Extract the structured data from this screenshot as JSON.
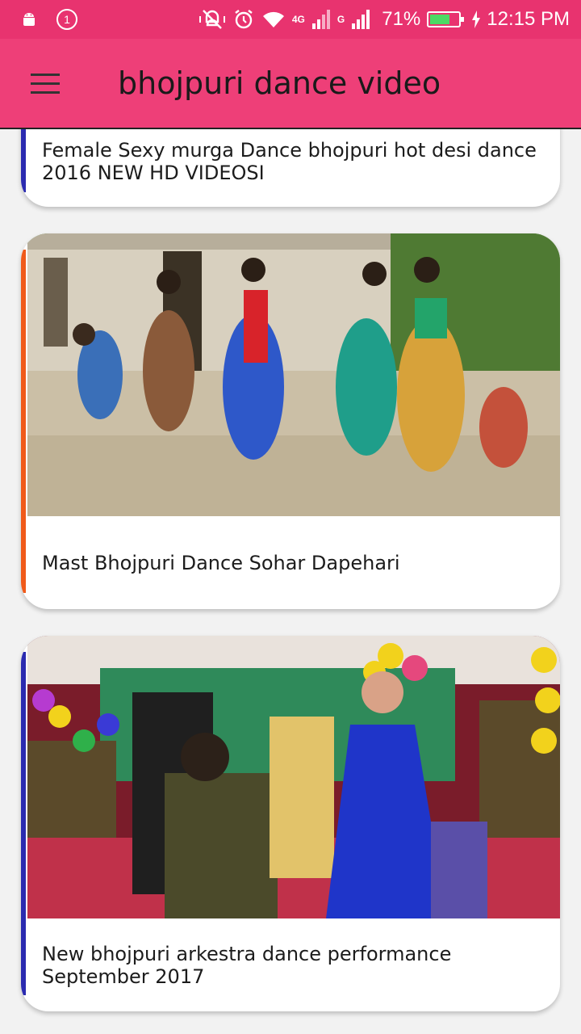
{
  "status_bar": {
    "notification_count": "1",
    "network_4g": "4G",
    "network_g": "G",
    "battery_percent": "71%",
    "battery_level": 0.71,
    "time": "12:15 PM"
  },
  "app_bar": {
    "title": "bhojpuri dance video"
  },
  "videos": [
    {
      "title": "Female Sexy murga Dance bhojpuri hot desi dance 2016 NEW HD VIDEOSI",
      "accent": "#2b2bb0"
    },
    {
      "title": "Mast Bhojpuri Dance Sohar  Dapehari",
      "accent": "#f05a1a"
    },
    {
      "title": "New bhojpuri arkestra dance performance September 2017",
      "accent": "#2b2bb0"
    }
  ],
  "colors": {
    "status_bar": "#e8336f",
    "app_bar": "#ee3f78"
  }
}
